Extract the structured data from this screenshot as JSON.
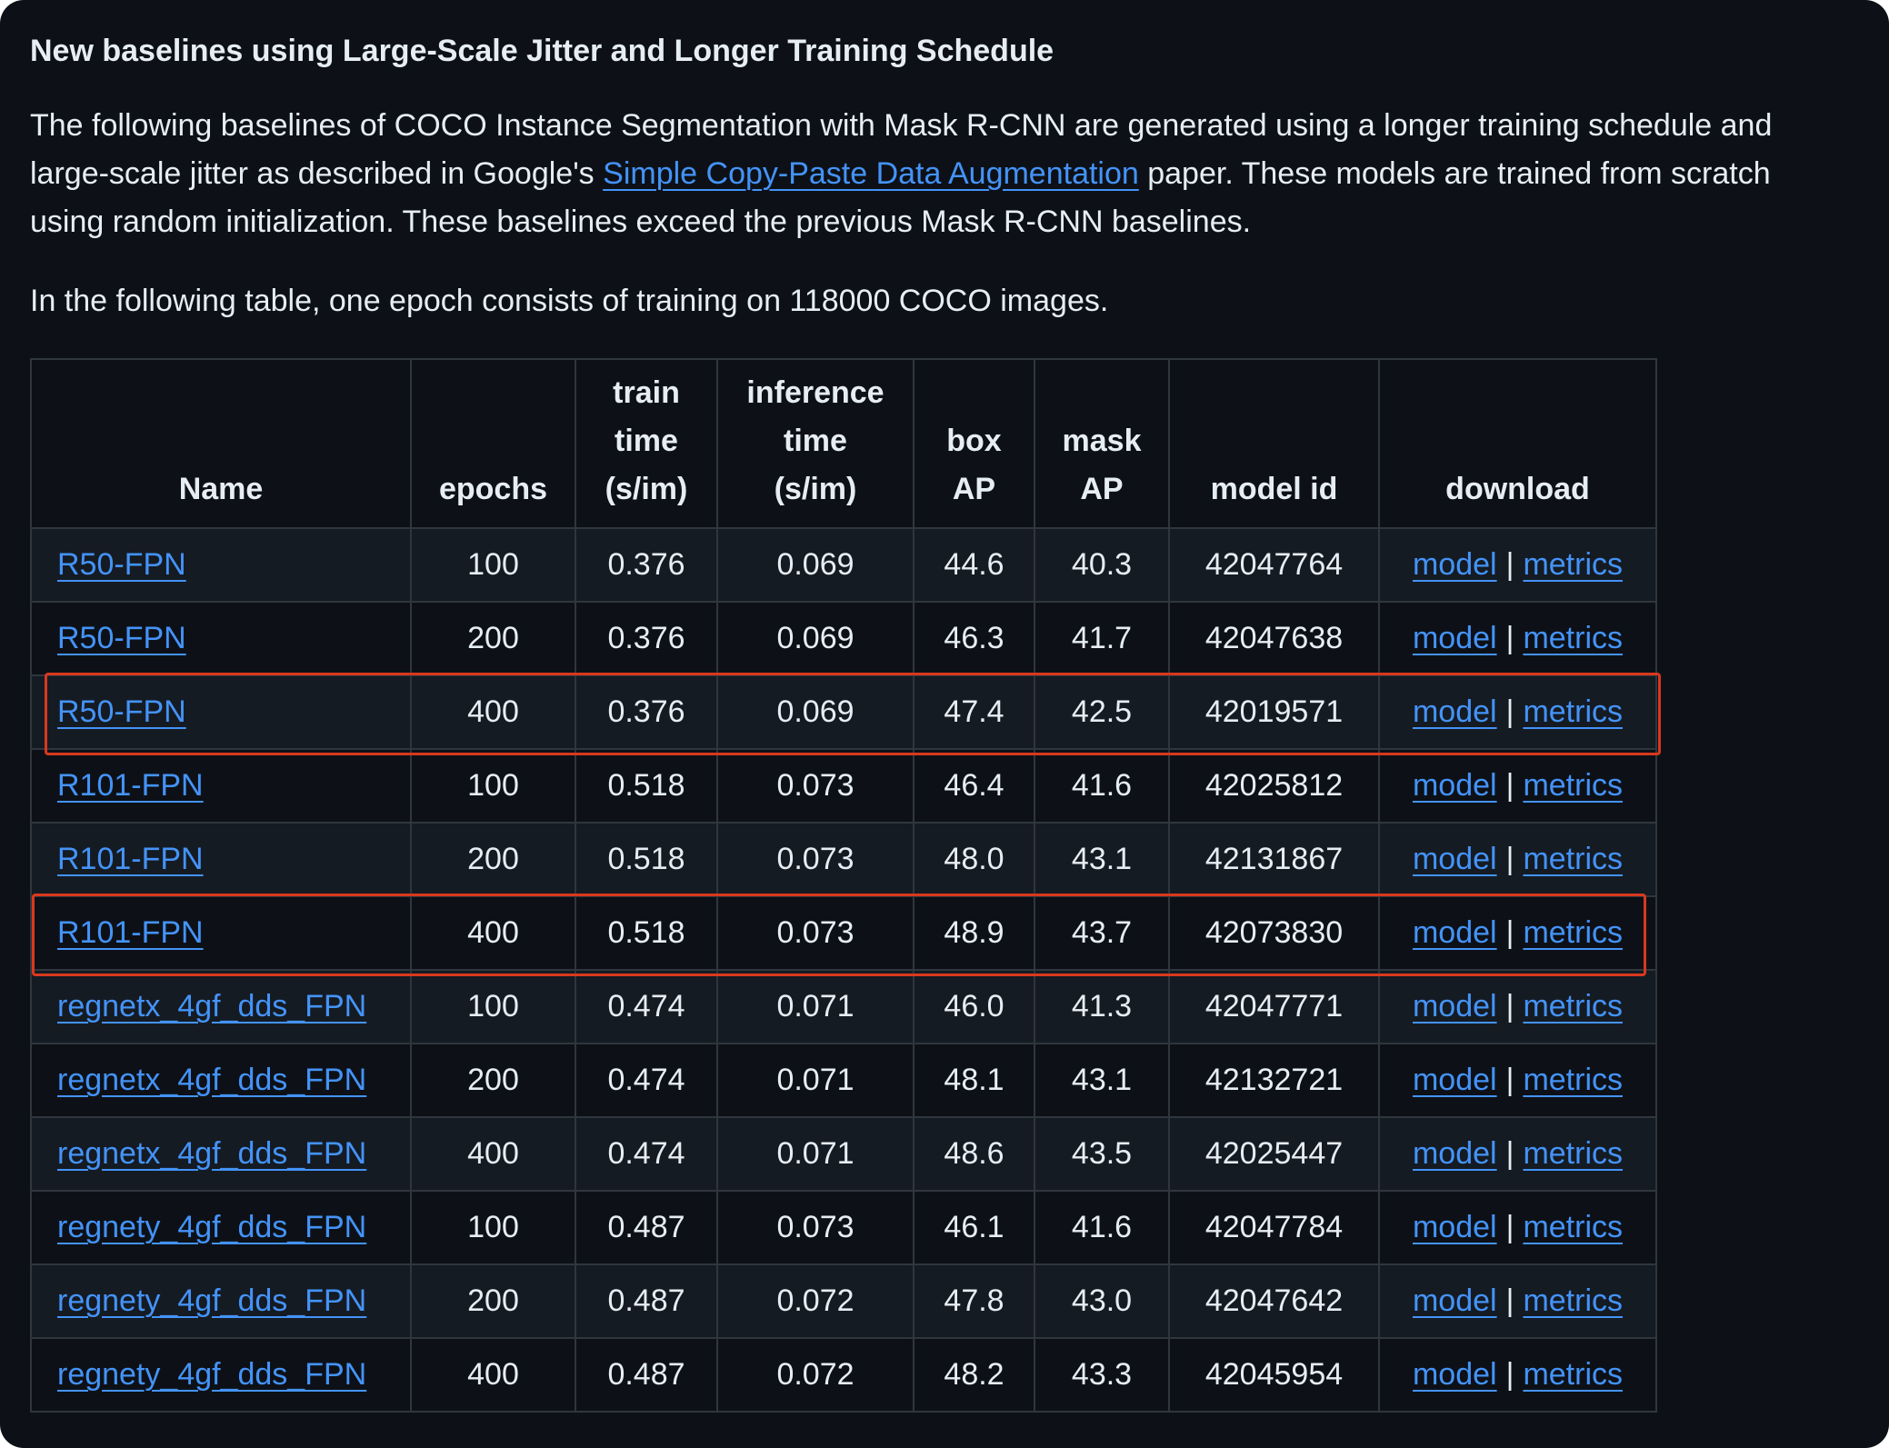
{
  "heading": "New baselines using Large-Scale Jitter and Longer Training Schedule",
  "intro": {
    "line1": "The following baselines of COCO Instance Segmentation with Mask R-CNN are generated using a longer training schedule and",
    "line2_prefix": "large-scale jitter as described in Google's ",
    "link_text": "Simple Copy-Paste Data Augmentation",
    "line2_suffix": " paper. These models are trained from scratch",
    "line3": "using random initialization. These baselines exceed the previous Mask R-CNN baselines."
  },
  "epoch_note": "In the following table, one epoch consists of training on 118000 COCO images.",
  "table": {
    "headers": {
      "name": "Name",
      "epochs": "epochs",
      "train_time": [
        "train",
        "time",
        "(s/im)"
      ],
      "inference_time": [
        "inference",
        "time",
        "(s/im)"
      ],
      "box_ap": [
        "box",
        "AP"
      ],
      "mask_ap": [
        "mask",
        "AP"
      ],
      "model_id": "model id",
      "download": "download"
    },
    "model_label": "model",
    "separator": "|",
    "metrics_label": "metrics",
    "rows": [
      {
        "name": "R50-FPN",
        "epochs": "100",
        "train_time": "0.376",
        "inference_time": "0.069",
        "box_ap": "44.6",
        "mask_ap": "40.3",
        "model_id": "42047764",
        "highlighted": false
      },
      {
        "name": "R50-FPN",
        "epochs": "200",
        "train_time": "0.376",
        "inference_time": "0.069",
        "box_ap": "46.3",
        "mask_ap": "41.7",
        "model_id": "42047638",
        "highlighted": false
      },
      {
        "name": "R50-FPN",
        "epochs": "400",
        "train_time": "0.376",
        "inference_time": "0.069",
        "box_ap": "47.4",
        "mask_ap": "42.5",
        "model_id": "42019571",
        "highlighted": true
      },
      {
        "name": "R101-FPN",
        "epochs": "100",
        "train_time": "0.518",
        "inference_time": "0.073",
        "box_ap": "46.4",
        "mask_ap": "41.6",
        "model_id": "42025812",
        "highlighted": false
      },
      {
        "name": "R101-FPN",
        "epochs": "200",
        "train_time": "0.518",
        "inference_time": "0.073",
        "box_ap": "48.0",
        "mask_ap": "43.1",
        "model_id": "42131867",
        "highlighted": false
      },
      {
        "name": "R101-FPN",
        "epochs": "400",
        "train_time": "0.518",
        "inference_time": "0.073",
        "box_ap": "48.9",
        "mask_ap": "43.7",
        "model_id": "42073830",
        "highlighted": true
      },
      {
        "name": "regnetx_4gf_dds_FPN",
        "epochs": "100",
        "train_time": "0.474",
        "inference_time": "0.071",
        "box_ap": "46.0",
        "mask_ap": "41.3",
        "model_id": "42047771",
        "highlighted": false
      },
      {
        "name": "regnetx_4gf_dds_FPN",
        "epochs": "200",
        "train_time": "0.474",
        "inference_time": "0.071",
        "box_ap": "48.1",
        "mask_ap": "43.1",
        "model_id": "42132721",
        "highlighted": false
      },
      {
        "name": "regnetx_4gf_dds_FPN",
        "epochs": "400",
        "train_time": "0.474",
        "inference_time": "0.071",
        "box_ap": "48.6",
        "mask_ap": "43.5",
        "model_id": "42025447",
        "highlighted": false
      },
      {
        "name": "regnety_4gf_dds_FPN",
        "epochs": "100",
        "train_time": "0.487",
        "inference_time": "0.073",
        "box_ap": "46.1",
        "mask_ap": "41.6",
        "model_id": "42047784",
        "highlighted": false
      },
      {
        "name": "regnety_4gf_dds_FPN",
        "epochs": "200",
        "train_time": "0.487",
        "inference_time": "0.072",
        "box_ap": "47.8",
        "mask_ap": "43.0",
        "model_id": "42047642",
        "highlighted": false
      },
      {
        "name": "regnety_4gf_dds_FPN",
        "epochs": "400",
        "train_time": "0.487",
        "inference_time": "0.072",
        "box_ap": "48.2",
        "mask_ap": "43.3",
        "model_id": "42045954",
        "highlighted": false
      }
    ]
  },
  "colors": {
    "background": "#0d1117",
    "text": "#e6edf3",
    "link": "#4493f8",
    "border": "#30363d",
    "row_alt": "#151b23",
    "highlight_box": "#d9381e"
  }
}
